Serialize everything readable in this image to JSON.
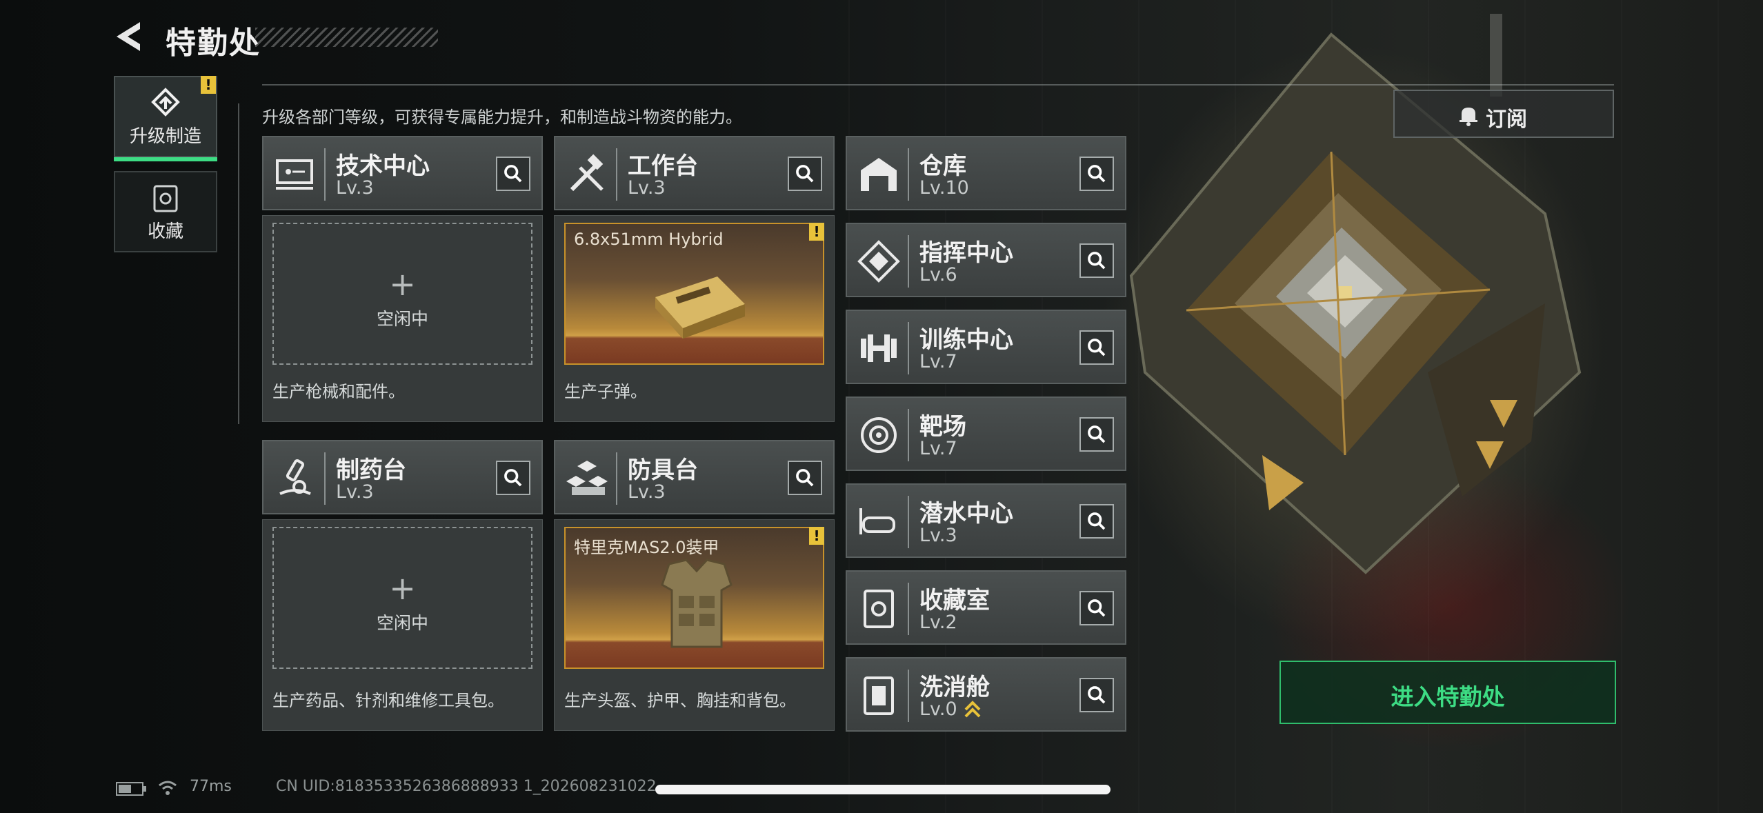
{
  "header": {
    "title": "特勤处"
  },
  "tabs": [
    {
      "label": "升级制造",
      "badge": "!"
    },
    {
      "label": "收藏"
    }
  ],
  "description": "升级各部门等级，可获得专属能力提升，和制造战斗物资的能力。",
  "subscribe": {
    "label": "订阅"
  },
  "enter": {
    "label": "进入特勤处"
  },
  "stations": [
    {
      "name": "技术中心",
      "level": "Lv.3",
      "icon": "tech-center-icon",
      "status": "空闲中",
      "plus": "+",
      "footer": "生产枪械和配件。"
    },
    {
      "name": "工作台",
      "level": "Lv.3",
      "icon": "workbench-icon",
      "product": "6.8x51mm Hybrid",
      "badge": "!",
      "footer": "生产子弹。"
    },
    {
      "name": "制药台",
      "level": "Lv.3",
      "icon": "pharmacy-icon",
      "status": "空闲中",
      "plus": "+",
      "footer": "生产药品、针剂和维修工具包。"
    },
    {
      "name": "防具台",
      "level": "Lv.3",
      "icon": "armor-bench-icon",
      "product": "特里克MAS2.0装甲",
      "badge": "!",
      "footer": "生产头盔、护甲、胸挂和背包。"
    }
  ],
  "facilities": [
    {
      "name": "仓库",
      "level": "Lv.10",
      "icon": "warehouse-icon"
    },
    {
      "name": "指挥中心",
      "level": "Lv.6",
      "icon": "command-center-icon"
    },
    {
      "name": "训练中心",
      "level": "Lv.7",
      "icon": "dumbbell-icon"
    },
    {
      "name": "靶场",
      "level": "Lv.7",
      "icon": "target-icon"
    },
    {
      "name": "潜水中心",
      "level": "Lv.3",
      "icon": "diving-mask-icon"
    },
    {
      "name": "收藏室",
      "level": "Lv.2",
      "icon": "collection-icon"
    },
    {
      "name": "洗消舱",
      "level": "Lv.0",
      "icon": "decon-icon",
      "upgrade": "upgrade-arrows-icon"
    }
  ],
  "statusbar": {
    "ping": "77ms",
    "uid": "CN UID:8183533526386888933 1_202608231022"
  },
  "colors": {
    "accent": "#3ddc84",
    "warning": "#e8c23a"
  }
}
